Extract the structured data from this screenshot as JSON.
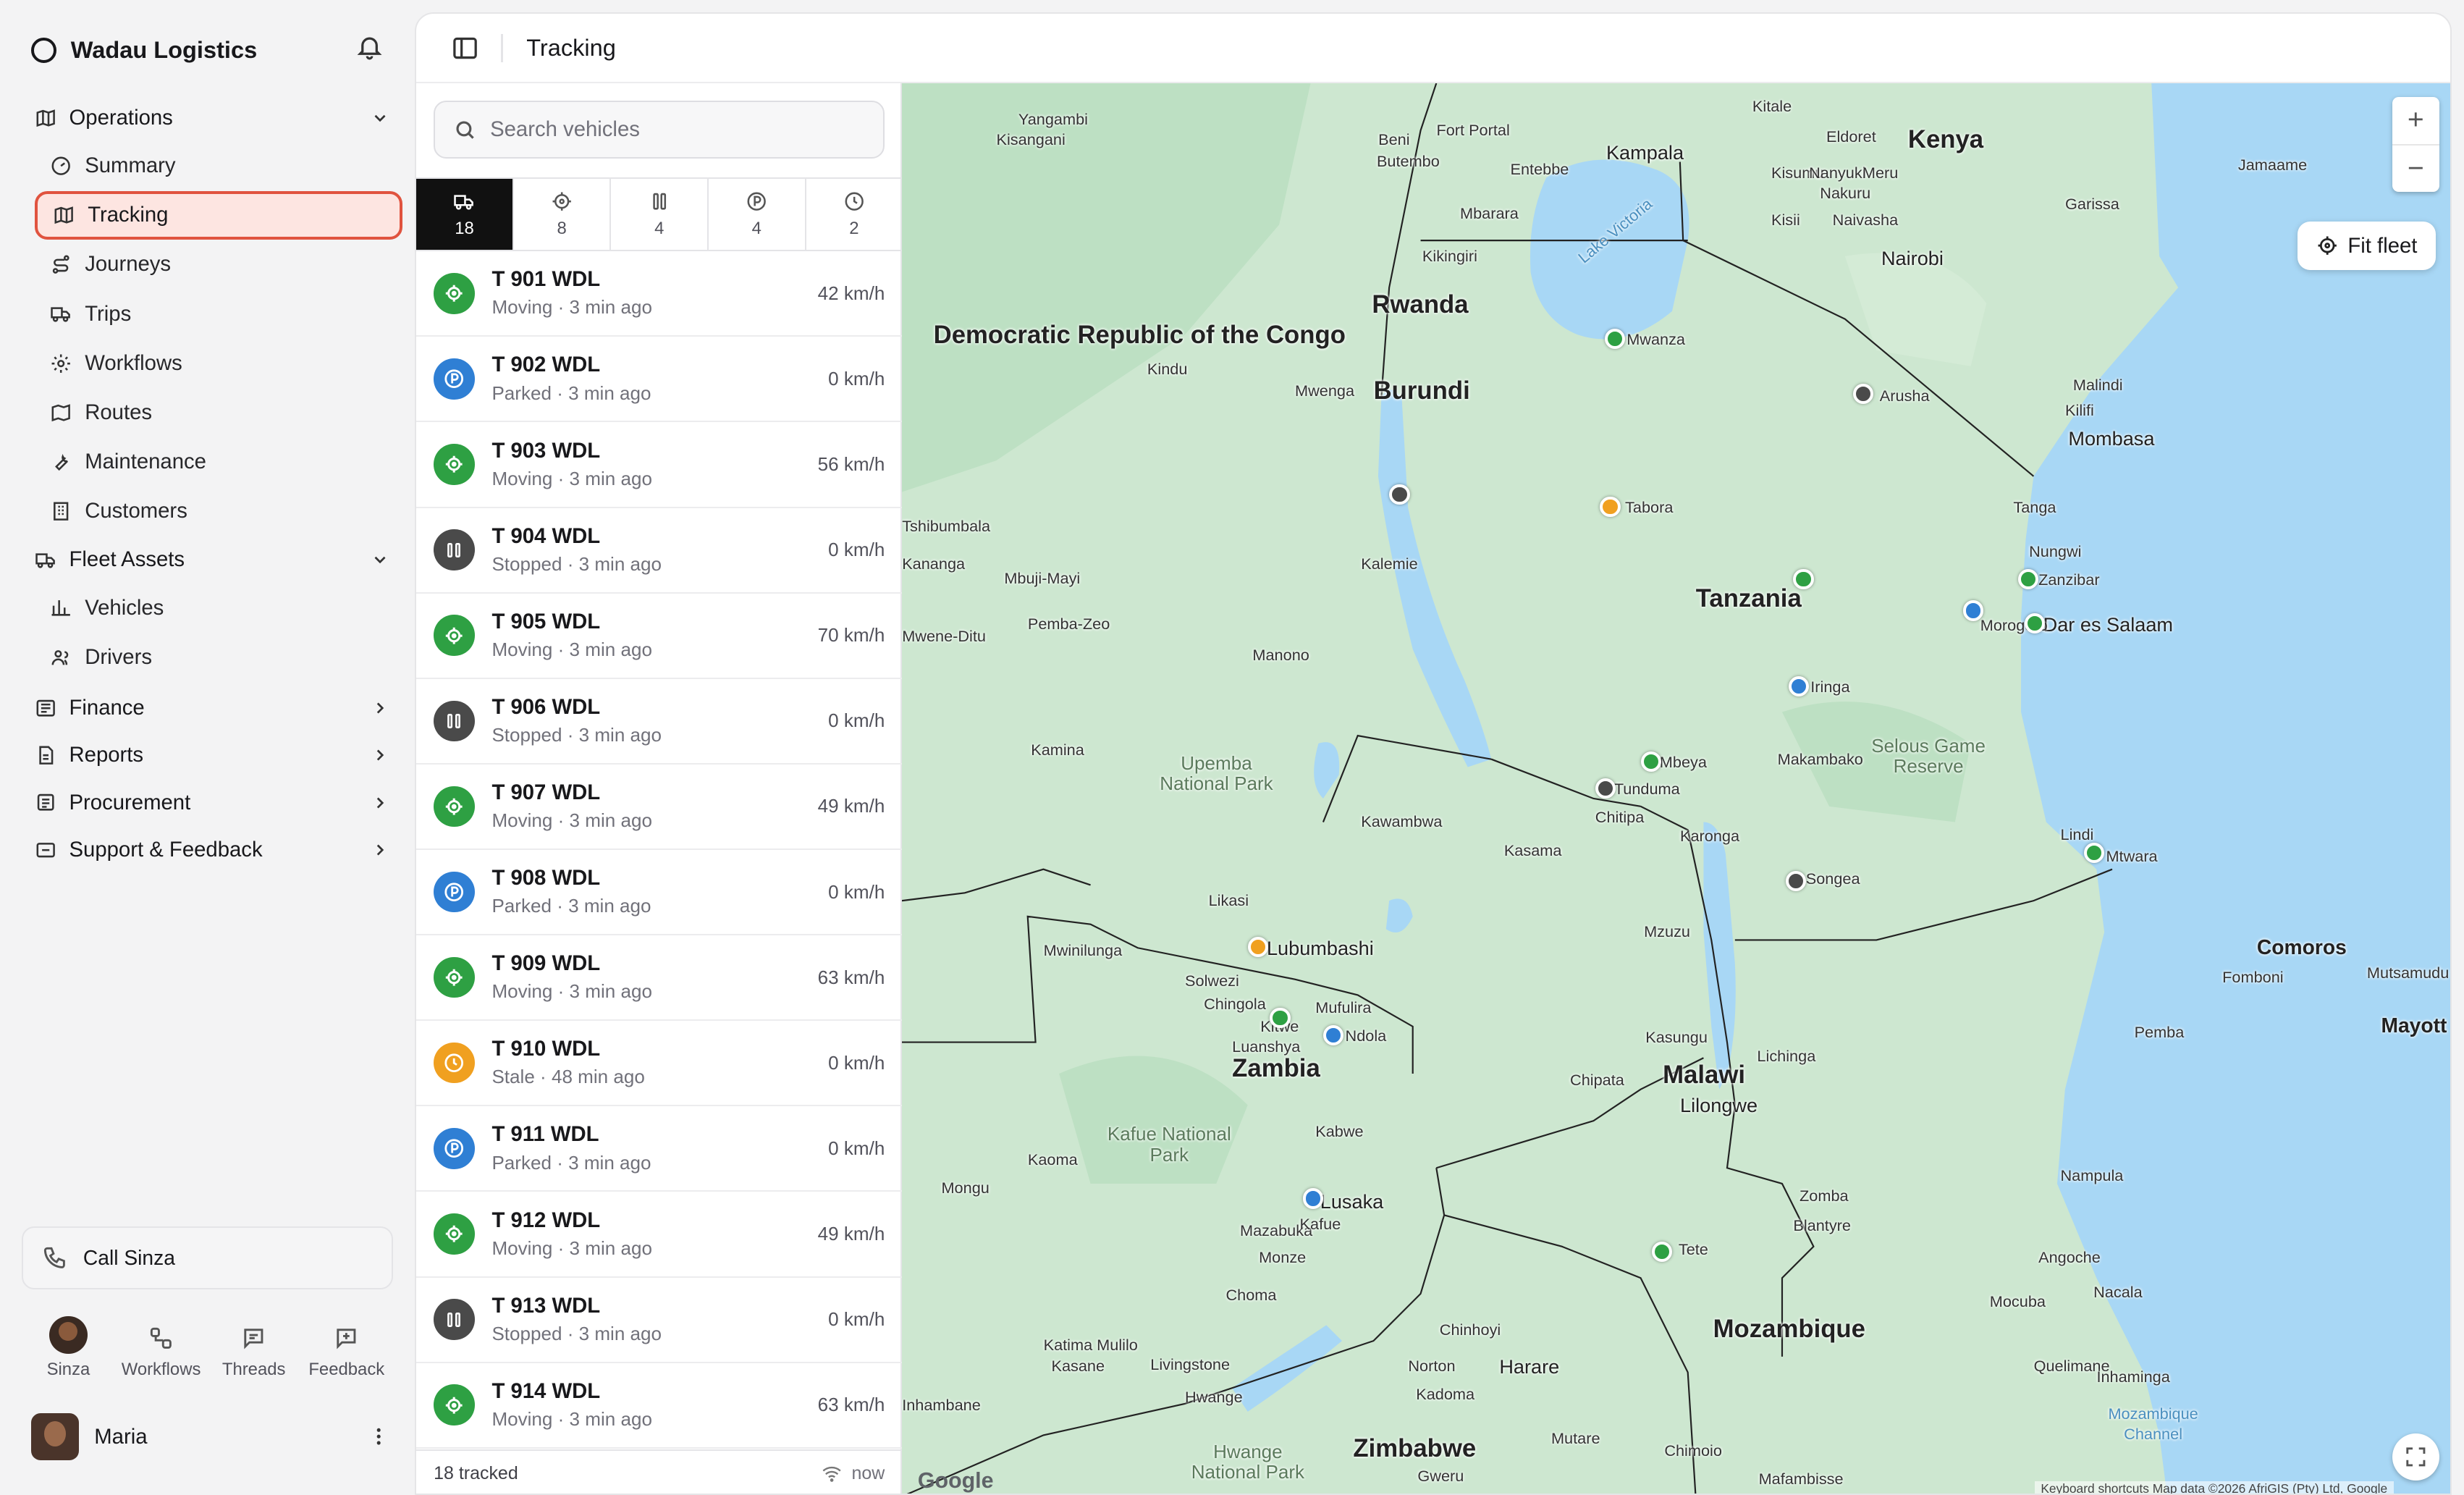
{
  "app": {
    "name": "Wadau Logistics"
  },
  "sidebar": {
    "groups": [
      {
        "label": "Operations",
        "items": [
          "Summary",
          "Tracking",
          "Journeys",
          "Trips",
          "Workflows",
          "Routes",
          "Maintenance",
          "Customers"
        ]
      },
      {
        "label": "Fleet Assets",
        "items": [
          "Vehicles",
          "Drivers"
        ]
      },
      {
        "label": "Finance"
      },
      {
        "label": "Reports"
      },
      {
        "label": "Procurement"
      },
      {
        "label": "Support & Feedback"
      }
    ],
    "active_item": "Tracking",
    "call_label": "Call Sinza",
    "tabs": [
      "Sinza",
      "Workflows",
      "Threads",
      "Feedback"
    ],
    "user_name": "Maria"
  },
  "header": {
    "title": "Tracking"
  },
  "search": {
    "placeholder": "Search vehicles"
  },
  "filters": [
    {
      "icon": "truck-icon",
      "count": "18"
    },
    {
      "icon": "moving-icon",
      "count": "8"
    },
    {
      "icon": "pause-icon",
      "count": "4"
    },
    {
      "icon": "parking-icon",
      "count": "4"
    },
    {
      "icon": "clock-icon",
      "count": "2"
    }
  ],
  "vehicles": [
    {
      "plate": "T 901 WDL",
      "status": "Moving · 3 min ago",
      "speed": "42 km/h",
      "state": "moving"
    },
    {
      "plate": "T 902 WDL",
      "status": "Parked · 3 min ago",
      "speed": "0 km/h",
      "state": "parked"
    },
    {
      "plate": "T 903 WDL",
      "status": "Moving · 3 min ago",
      "speed": "56 km/h",
      "state": "moving"
    },
    {
      "plate": "T 904 WDL",
      "status": "Stopped · 3 min ago",
      "speed": "0 km/h",
      "state": "stopped"
    },
    {
      "plate": "T 905 WDL",
      "status": "Moving · 3 min ago",
      "speed": "70 km/h",
      "state": "moving"
    },
    {
      "plate": "T 906 WDL",
      "status": "Stopped · 3 min ago",
      "speed": "0 km/h",
      "state": "stopped"
    },
    {
      "plate": "T 907 WDL",
      "status": "Moving · 3 min ago",
      "speed": "49 km/h",
      "state": "moving"
    },
    {
      "plate": "T 908 WDL",
      "status": "Parked · 3 min ago",
      "speed": "0 km/h",
      "state": "parked"
    },
    {
      "plate": "T 909 WDL",
      "status": "Moving · 3 min ago",
      "speed": "63 km/h",
      "state": "moving"
    },
    {
      "plate": "T 910 WDL",
      "status": "Stale · 48 min ago",
      "speed": "0 km/h",
      "state": "stale"
    },
    {
      "plate": "T 911 WDL",
      "status": "Parked · 3 min ago",
      "speed": "0 km/h",
      "state": "parked"
    },
    {
      "plate": "T 912 WDL",
      "status": "Moving · 3 min ago",
      "speed": "49 km/h",
      "state": "moving"
    },
    {
      "plate": "T 913 WDL",
      "status": "Stopped · 3 min ago",
      "speed": "0 km/h",
      "state": "stopped"
    },
    {
      "plate": "T 914 WDL",
      "status": "Moving · 3 min ago",
      "speed": "63 km/h",
      "state": "moving"
    }
  ],
  "footer": {
    "tracked": "18 tracked",
    "refresh": "now"
  },
  "map": {
    "fit_label": "Fit fleet",
    "zoom_in": "+",
    "zoom_out": "−",
    "countries": [
      "Kenya",
      "Rwanda",
      "Burundi",
      "Democratic Republic of the Congo",
      "Tanzania",
      "Zambia",
      "Malawi",
      "Mozambique",
      "Zimbabwe",
      "Comoros",
      "Mayott"
    ],
    "cities": [
      "Kampala",
      "Nairobi",
      "Mombasa",
      "Dar es Salaam",
      "Lubumbashi",
      "Lusaka",
      "Lilongwe",
      "Harare",
      "Mwanza",
      "Arusha",
      "Tabora",
      "Morogoro",
      "Iringa",
      "Mbeya",
      "Zanzibar",
      "Mtwara",
      "Songea",
      "Tunduma",
      "Ndola",
      "Kitwe",
      "Tete"
    ],
    "towns": [
      "Yangambi",
      "Kisangani",
      "Fort Portal",
      "Beni",
      "Butembo",
      "Entebbe",
      "Kitale",
      "Eldoret",
      "Kisumu",
      "Nanyuki",
      "Meru",
      "Nakuru",
      "Naivasha",
      "Kisii",
      "Mbarara",
      "Kikingiri",
      "Garissa",
      "Jamaame",
      "Kindu",
      "Mwenga",
      "Malindi",
      "Kilifi",
      "Tanga",
      "Nungwi",
      "Tshibumbala",
      "Kananga",
      "Mbuji-Mayi",
      "Kalemie",
      "Mwene-Ditu",
      "Pemba-Zeo",
      "Manono",
      "Makambako",
      "Kamina",
      "Kawambwa",
      "Kasama",
      "Chitipa",
      "Karonga",
      "Lindi",
      "Likasi",
      "Mwinilunga",
      "Solwezi",
      "Chingola",
      "Mufulira",
      "Luanshya",
      "Mzuzu",
      "Kasungu",
      "Lichinga",
      "Pemba",
      "Fomboni",
      "Mutsamudu",
      "Chipata",
      "Kabwe",
      "Kaoma",
      "Mongu",
      "Mazabuka",
      "Kafue",
      "Monze",
      "Choma",
      "Zomba",
      "Blantyre",
      "Angoche",
      "Nacala",
      "Nampula",
      "Mocuba",
      "Quelimane",
      "Inhambane",
      "Katima Mulilo",
      "Kasane",
      "Livingstone",
      "Hwange",
      "Chinhoyi",
      "Norton",
      "Kadoma",
      "Mutare",
      "Chimoio",
      "Gweru",
      "Mafambisse",
      "Inhaminga"
    ],
    "parks": [
      "Upemba National Park",
      "Kafue National Park",
      "Hwange National Park",
      "Selous Game Reserve",
      "Mozambique Channel"
    ],
    "lakes": [
      "Lake Victoria"
    ],
    "attribution": "Keyboard shortcuts  Map data ©2026 AfriGIS (Pty) Ltd, Google",
    "google": "Google",
    "pins": [
      {
        "place": "Mwanza",
        "state": "moving"
      },
      {
        "place": "Arusha",
        "state": "stopped"
      },
      {
        "place": "Tabora",
        "state": "stale"
      },
      {
        "place": "Kigoma area",
        "state": "stopped"
      },
      {
        "place": "Dodoma area",
        "state": "moving"
      },
      {
        "place": "Morogoro",
        "state": "parked"
      },
      {
        "place": "Zanzibar",
        "state": "moving"
      },
      {
        "place": "Dar es Salaam",
        "state": "moving"
      },
      {
        "place": "Iringa",
        "state": "parked"
      },
      {
        "place": "Mbeya",
        "state": "moving"
      },
      {
        "place": "Tunduma",
        "state": "stopped"
      },
      {
        "place": "Songea",
        "state": "stopped"
      },
      {
        "place": "Mtwara",
        "state": "moving"
      },
      {
        "place": "Lubumbashi",
        "state": "stale"
      },
      {
        "place": "Kitwe",
        "state": "moving"
      },
      {
        "place": "Ndola",
        "state": "parked"
      },
      {
        "place": "Lusaka",
        "state": "parked"
      },
      {
        "place": "Tete",
        "state": "moving"
      }
    ]
  },
  "colors": {
    "moving": "#2ea043",
    "parked": "#2f7fd4",
    "stopped": "#4a4a4a",
    "stale": "#f0a020",
    "active_accent": "#e0533f"
  }
}
